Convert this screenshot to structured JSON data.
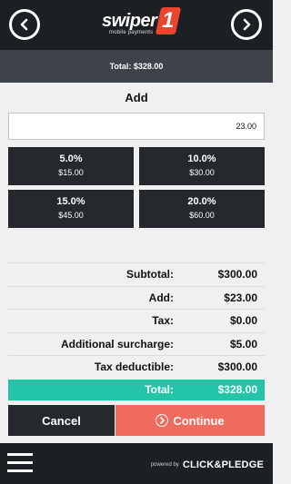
{
  "header": {
    "back_icon": "chevron-left-icon",
    "forward_icon": "chevron-right-icon",
    "logo_text": "swiper",
    "logo_number": "1",
    "logo_tagline": "mobile payments"
  },
  "total_bar": {
    "text": "Total: $328.00"
  },
  "add_section": {
    "title": "Add",
    "input_value": "23.00"
  },
  "tips": [
    {
      "percent": "5.0%",
      "amount": "$15.00"
    },
    {
      "percent": "10.0%",
      "amount": "$30.00"
    },
    {
      "percent": "15.0%",
      "amount": "$45.00"
    },
    {
      "percent": "20.0%",
      "amount": "$60.00"
    }
  ],
  "summary": [
    {
      "label": "Subtotal:",
      "value": "$300.00"
    },
    {
      "label": "Add:",
      "value": "$23.00"
    },
    {
      "label": "Tax:",
      "value": "$0.00"
    },
    {
      "label": "Additional surcharge:",
      "value": "$5.00"
    },
    {
      "label": "Tax deductible:",
      "value": "$300.00"
    }
  ],
  "total_row": {
    "label": "Total:",
    "value": "$328.00"
  },
  "buttons": {
    "cancel": "Cancel",
    "continue": "Continue"
  },
  "footer": {
    "menu_icon": "hamburger-menu-icon",
    "powered_by": "powered by",
    "brand": "CLICK&PLEDGE"
  },
  "colors": {
    "header_bg": "#1c1f24",
    "total_bar_bg": "#3e4249",
    "tip_bg": "#25282d",
    "total_accent": "#23c4a8",
    "continue_accent": "#ef6b5e"
  }
}
